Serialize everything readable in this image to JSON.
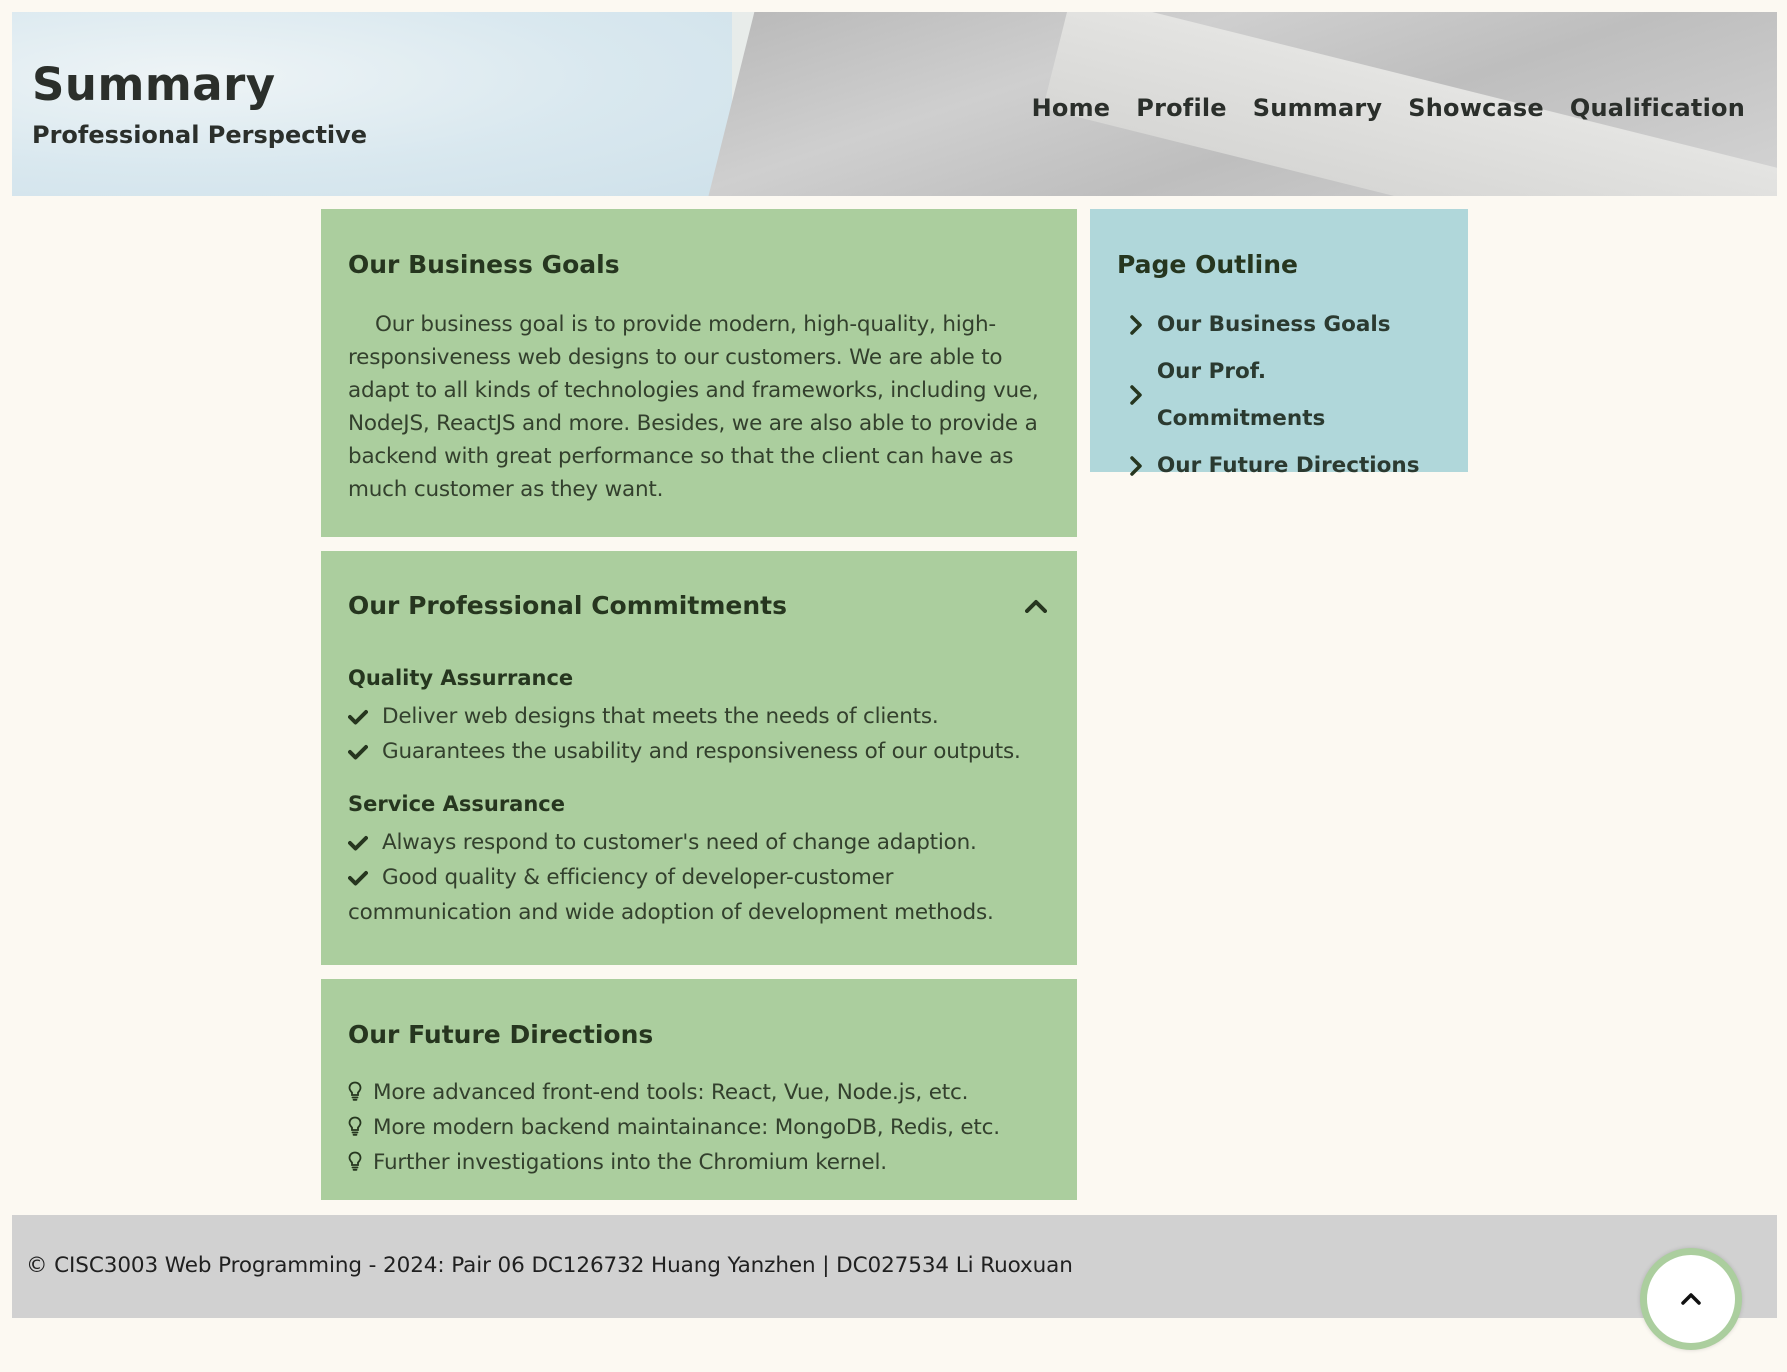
{
  "header": {
    "title": "Summary",
    "subtitle": "Professional Perspective",
    "nav": [
      "Home",
      "Profile",
      "Summary",
      "Showcase",
      "Qualification"
    ]
  },
  "goals": {
    "title": "Our Business Goals",
    "text": "Our business goal is to provide modern, high-quality, high-responsiveness web designs to our customers. We are able to adapt to all kinds of technologies and frameworks, including vue, NodeJS, ReactJS and more. Besides, we are also able to provide a backend with great performance so that the client can have as much customer as they want."
  },
  "commitments": {
    "title": "Our Professional Commitments",
    "quality": {
      "heading": "Quality Assurrance",
      "items": [
        "Deliver web designs that meets the needs of clients.",
        "Guarantees the usability and responsiveness of our outputs."
      ]
    },
    "service": {
      "heading": "Service Assurance",
      "items": [
        "Always respond to customer's need of change adaption.",
        "Good quality & efficiency of developer-customer communication and wide adoption of development methods."
      ]
    }
  },
  "future": {
    "title": "Our Future Directions",
    "items": [
      "More advanced front-end tools: React, Vue, Node.js, etc.",
      "More modern backend maintainance: MongoDB, Redis, etc.",
      "Further investigations into the Chromium kernel."
    ]
  },
  "outline": {
    "title": "Page Outline",
    "items": [
      "Our Business Goals",
      "Our Prof. Commitments",
      "Our Future Directions"
    ]
  },
  "footer": {
    "copyright": "© CISC3003 Web Programming - 2024: Pair 06 DC126732 Huang Yanzhen | DC027534 Li Ruoxuan"
  },
  "icons": {
    "collapse": "chevron-up-icon",
    "check": "check-icon",
    "bulb": "lightbulb-icon",
    "outline_arrow": "chevron-right-icon",
    "back_to_top": "chevron-up-icon"
  },
  "colors": {
    "page_bg": "#fcf9f2",
    "card_green": "#abce9e",
    "outline_blue": "#b0d7da",
    "footer_gray": "#d1d1d1"
  }
}
